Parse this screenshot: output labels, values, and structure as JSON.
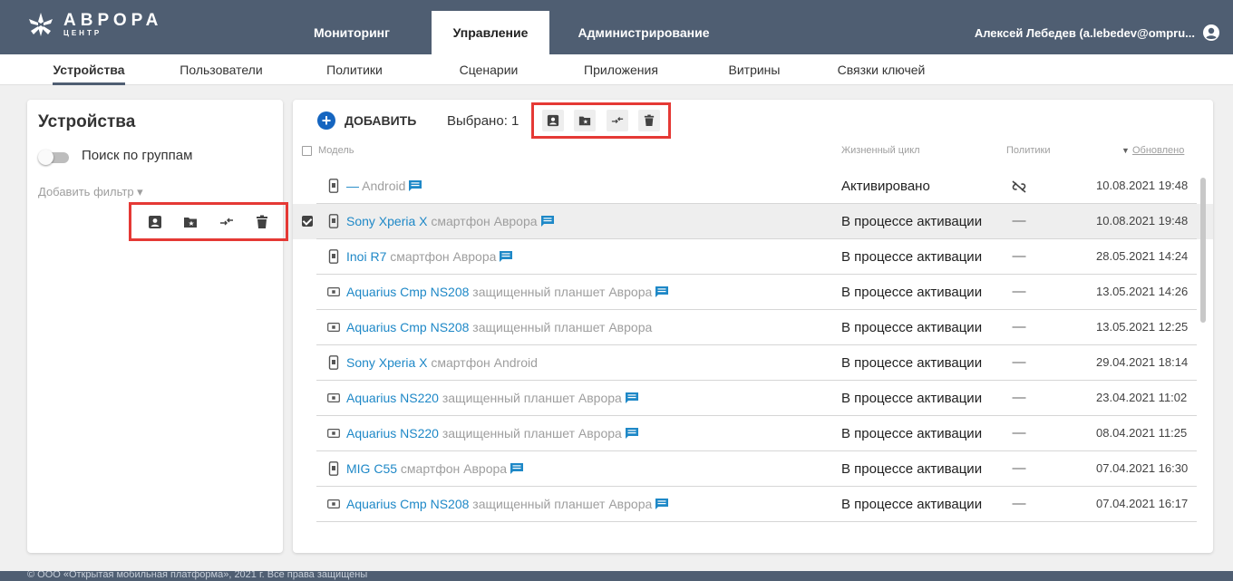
{
  "header": {
    "logo_main": "АВРОРА",
    "logo_sub": "ЦЕНТР",
    "nav": [
      {
        "label": "Мониторинг"
      },
      {
        "label": "Управление"
      },
      {
        "label": "Администрирование"
      }
    ],
    "user": "Алексей Лебедев (a.lebedev@ompru..."
  },
  "subnav": [
    {
      "label": "Устройства"
    },
    {
      "label": "Пользователи"
    },
    {
      "label": "Политики"
    },
    {
      "label": "Сценарии"
    },
    {
      "label": "Приложения"
    },
    {
      "label": "Витрины"
    },
    {
      "label": "Связки ключей"
    }
  ],
  "sidebar": {
    "title": "Устройства",
    "toggle_label": "Поиск по группам",
    "add_filter": "Добавить фильтр ▾"
  },
  "toolbar": {
    "add_label": "ДОБАВИТЬ",
    "selected_label": "Выбрано: 1"
  },
  "table": {
    "columns": {
      "model": "Модель",
      "lifecycle": "Жизненный цикл",
      "policies": "Политики",
      "updated": "Обновлено"
    },
    "rows": [
      {
        "name": "— ",
        "type": "Android",
        "chat": true,
        "status": "Активировано",
        "policy": "unlink-icon",
        "date": "10.08.2021 19:48",
        "device": "phone"
      },
      {
        "name": "Sony Xperia X",
        "type": " смартфон Аврора",
        "chat": true,
        "status": "В процессе активации",
        "policy": "—",
        "date": "10.08.2021 19:48",
        "device": "phone",
        "selected": true
      },
      {
        "name": "Inoi R7",
        "type": " смартфон Аврора",
        "chat": true,
        "status": "В процессе активации",
        "policy": "—",
        "date": "28.05.2021 14:24",
        "device": "phone"
      },
      {
        "name": "Aquarius Cmp NS208",
        "type": " защищенный планшет Аврора",
        "chat": true,
        "status": "В процессе активации",
        "policy": "—",
        "date": "13.05.2021 14:26",
        "device": "tablet"
      },
      {
        "name": "Aquarius Cmp NS208",
        "type": " защищенный планшет Аврора",
        "chat": false,
        "status": "В процессе активации",
        "policy": "—",
        "date": "13.05.2021 12:25",
        "device": "tablet"
      },
      {
        "name": "Sony Xperia X",
        "type": " смартфон Android",
        "chat": false,
        "status": "В процессе активации",
        "policy": "—",
        "date": "29.04.2021 18:14",
        "device": "phone"
      },
      {
        "name": "Aquarius NS220",
        "type": " защищенный планшет Аврора",
        "chat": true,
        "status": "В процессе активации",
        "policy": "—",
        "date": "23.04.2021 11:02",
        "device": "tablet"
      },
      {
        "name": "Aquarius NS220",
        "type": " защищенный планшет Аврора",
        "chat": true,
        "status": "В процессе активации",
        "policy": "—",
        "date": "08.04.2021 11:25",
        "device": "tablet"
      },
      {
        "name": "MIG C55",
        "type": " смартфон Аврора",
        "chat": true,
        "status": "В процессе активации",
        "policy": "—",
        "date": "07.04.2021 16:30",
        "device": "phone"
      },
      {
        "name": "Aquarius Cmp NS208",
        "type": " защищенный планшет Аврора",
        "chat": true,
        "status": "В процессе активации",
        "policy": "—",
        "date": "07.04.2021 16:17",
        "device": "tablet"
      }
    ]
  },
  "footer": {
    "text": "© ООО «Открытая мобильная платформа», 2021 г. Все права защищены"
  },
  "colors": {
    "topbar": "#4f5e72",
    "link": "#1e88c7",
    "accent_blue": "#1565c0",
    "highlight_red": "#e53935"
  }
}
